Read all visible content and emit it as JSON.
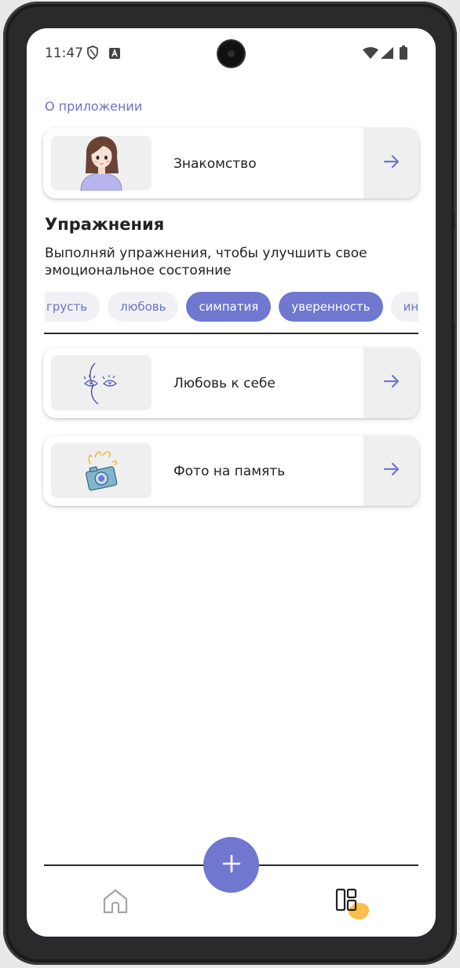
{
  "status_bar": {
    "time": "11:47"
  },
  "about": {
    "section_label": "О приложении",
    "card": {
      "title": "Знакомство"
    }
  },
  "exercises": {
    "heading": "Упражнения",
    "description": "Выполняй упражнения, чтобы улучшить свое эмоциональное состояние",
    "chips": [
      {
        "label": "грусть",
        "selected": false
      },
      {
        "label": "любовь",
        "selected": false
      },
      {
        "label": "симпатия",
        "selected": true
      },
      {
        "label": "уверенность",
        "selected": true
      },
      {
        "label": "ин",
        "selected": false
      }
    ],
    "cards": [
      {
        "title": "Любовь к себе"
      },
      {
        "title": "Фото на память"
      }
    ]
  },
  "colors": {
    "accent": "#6f77cf",
    "link": "#6b73c8",
    "nav_blob": "#fbbf4b"
  },
  "icons": {
    "status": [
      "shield-icon",
      "font-a-icon",
      "wifi-icon",
      "signal-icon",
      "battery-icon"
    ],
    "card_action": "arrow-right-icon",
    "nav": [
      "home-icon",
      "add-icon",
      "dashboard-icon"
    ]
  }
}
